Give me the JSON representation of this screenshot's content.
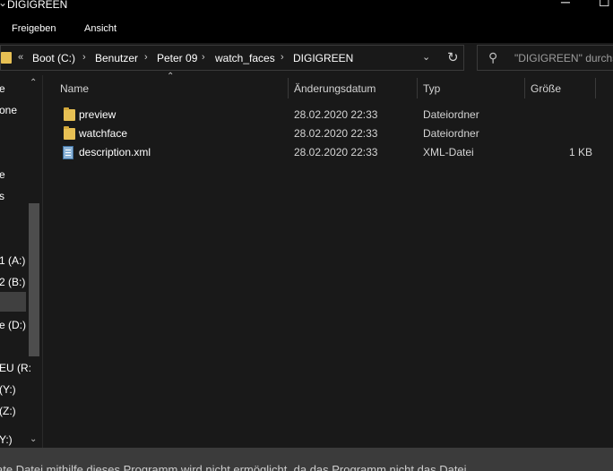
{
  "window": {
    "title": "DIGIGREEN",
    "min_glyph": "─",
    "max_glyph": "☐"
  },
  "ribbon": {
    "tabs": [
      {
        "label": "Freigeben"
      },
      {
        "label": "Ansicht"
      }
    ]
  },
  "address": {
    "overflow_glyph": "«",
    "breadcrumb": [
      {
        "label": "Boot (C:)"
      },
      {
        "label": "Benutzer"
      },
      {
        "label": "Peter 09"
      },
      {
        "label": "watch_faces"
      },
      {
        "label": "DIGIGREEN"
      }
    ],
    "separator": "›",
    "dropdown_glyph": "⌄",
    "refresh_glyph": "↻"
  },
  "search": {
    "placeholder": "\"DIGIGREEN\" durchsu",
    "icon_glyph": "⚲"
  },
  "nav": {
    "items": [
      {
        "label": "e"
      },
      {
        "label": "one"
      },
      {
        "label": "e"
      },
      {
        "label": "s"
      },
      {
        "label": "1 (A:)"
      },
      {
        "label": "2 (B:)"
      },
      {
        "label": "e (D:)"
      },
      {
        "label": "EU (R:"
      },
      {
        "label": "(Y:)"
      },
      {
        "label": "(Z:)"
      },
      {
        "label": "Y:)"
      }
    ],
    "scroll_up": "⌃",
    "scroll_down": "⌄"
  },
  "columns": {
    "name": "Name",
    "date": "Änderungsdatum",
    "type": "Typ",
    "size": "Größe",
    "sort_glyph": "⌃"
  },
  "files": [
    {
      "name": "preview",
      "date": "28.02.2020 22:33",
      "type": "Dateiordner",
      "size": "",
      "icon": "folder-icon"
    },
    {
      "name": "watchface",
      "date": "28.02.2020 22:33",
      "type": "Dateiordner",
      "size": "",
      "icon": "folder-icon"
    },
    {
      "name": "description.xml",
      "date": "28.02.2020 22:33",
      "type": "XML-Datei",
      "size": "1 KB",
      "icon": "xml-file-icon"
    }
  ],
  "colors": {
    "background": "#191919",
    "chrome": "#000000",
    "folder": "#e7c054",
    "status_bar": "#3b3b3b"
  },
  "status": {
    "text": "ate Datei mithilfe dieses Programm wird nicht ermöglicht, da das Programm nicht das Datei"
  }
}
